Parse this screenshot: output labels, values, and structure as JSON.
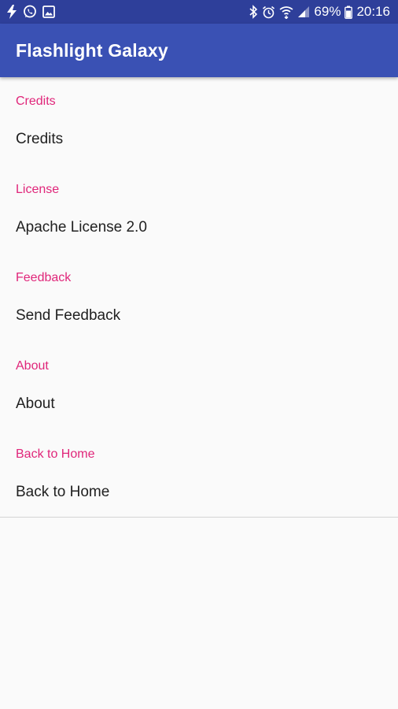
{
  "status_bar": {
    "battery": "69%",
    "time": "20:16",
    "left_icons": [
      "flash-icon",
      "whatsapp-icon",
      "gallery-icon"
    ],
    "right_icons": [
      "bluetooth-icon",
      "alarm-icon",
      "wifi-icon",
      "signal-icon",
      "battery-icon"
    ]
  },
  "app_bar": {
    "title": "Flashlight Galaxy",
    "color": "#3a51b4"
  },
  "categories": [
    {
      "header": "Credits",
      "item": "Credits"
    },
    {
      "header": "License",
      "item": "Apache License 2.0"
    },
    {
      "header": "Feedback",
      "item": "Send Feedback"
    },
    {
      "header": "About",
      "item": "About"
    },
    {
      "header": "Back to Home",
      "item": "Back to Home"
    }
  ],
  "colors": {
    "accent": "#e0267a",
    "status_bar": "#2e3f9a",
    "background": "#fafafa"
  }
}
